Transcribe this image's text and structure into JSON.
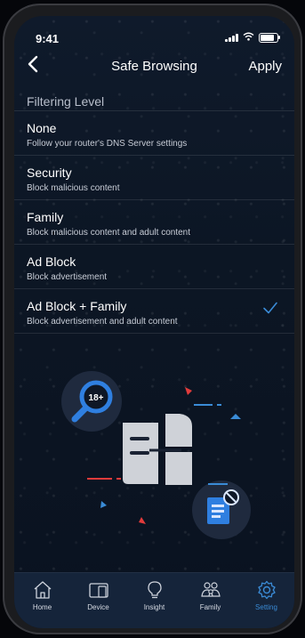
{
  "status_bar": {
    "time": "9:41"
  },
  "header": {
    "back_icon": "chevron-left-icon",
    "title": "Safe Browsing",
    "apply_label": "Apply"
  },
  "section": {
    "label": "Filtering Level"
  },
  "levels": [
    {
      "title": "None",
      "subtitle": "Follow your router's DNS  Server settings",
      "selected": false
    },
    {
      "title": "Security",
      "subtitle": "Block malicious content",
      "selected": false
    },
    {
      "title": "Family",
      "subtitle": "Block malicious content and adult content",
      "selected": false
    },
    {
      "title": "Ad Block",
      "subtitle": "Block advertisement",
      "selected": false
    },
    {
      "title": "Ad Block + Family",
      "subtitle": "Block advertisement and adult content",
      "selected": true
    }
  ],
  "illustration": {
    "badge_text": "18+"
  },
  "tabs": [
    {
      "label": "Home",
      "icon": "home-icon",
      "active": false
    },
    {
      "label": "Device",
      "icon": "device-icon",
      "active": false
    },
    {
      "label": "Insight",
      "icon": "lightbulb-icon",
      "active": false
    },
    {
      "label": "Family",
      "icon": "family-icon",
      "active": false
    },
    {
      "label": "Setting",
      "icon": "gear-icon",
      "active": true
    }
  ],
  "colors": {
    "accent": "#3a8bd6",
    "background": "#0c1624",
    "tabbar": "#15243a"
  }
}
